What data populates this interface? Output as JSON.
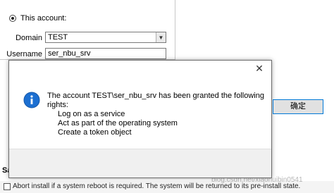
{
  "background": {
    "radio_label": "This account:",
    "domain_label": "Domain",
    "domain_value": "TEST",
    "username_label": "Username",
    "username_value": "ser_nbu_srv",
    "section_partial": "Sa",
    "abort_text": "Abort install if a system reboot is required. The system will be returned to its pre-install state.",
    "watermark": "blog.csdn.net/xiaohuibin0541"
  },
  "dialog": {
    "message_line1": "The account TEST\\ser_nbu_srv has been granted the following",
    "message_line2": "rights:",
    "rights": [
      "Log on as a service",
      "Act as part of the operating system",
      "Create a token object"
    ],
    "ok_label": "确定",
    "close_glyph": "✕",
    "info_color": "#1c6fd1"
  }
}
